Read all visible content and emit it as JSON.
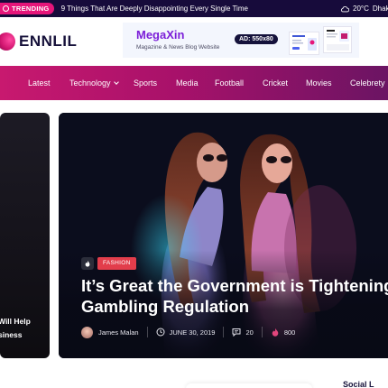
{
  "topbar": {
    "trending_label": "TRENDING",
    "headline": "9 Things That Are Deeply Disappointing Every Single Time",
    "temperature": "20°C",
    "city": "Dhaka",
    "weather_icon": "cloud-icon"
  },
  "header": {
    "logo_text": "ENNLIL",
    "ad": {
      "title": "MegaXin",
      "subtitle": "Magazine & News Blog Website",
      "size_label": "AD: 550x80"
    }
  },
  "nav": {
    "items": [
      "Latest",
      "Technology",
      "Sports",
      "Media",
      "Football",
      "Cricket",
      "Movies",
      "Celebrety"
    ]
  },
  "left_card": {
    "title_line1": "Will Help",
    "title_line2": "siness"
  },
  "hero": {
    "category": "FASHION",
    "title": "It’s Great the Government is Tightening Gambling Regulation",
    "author": "James Malan",
    "date": "JUNE 30, 2019",
    "comments": "20",
    "views": "800"
  },
  "sidebar": {
    "social_title": "Social L"
  },
  "colors": {
    "topbar_bg": "#170b3b",
    "accent": "#e6157a",
    "nav_start": "#c8196f",
    "nav_end": "#6b1463",
    "category_badge": "#e23d4b"
  }
}
